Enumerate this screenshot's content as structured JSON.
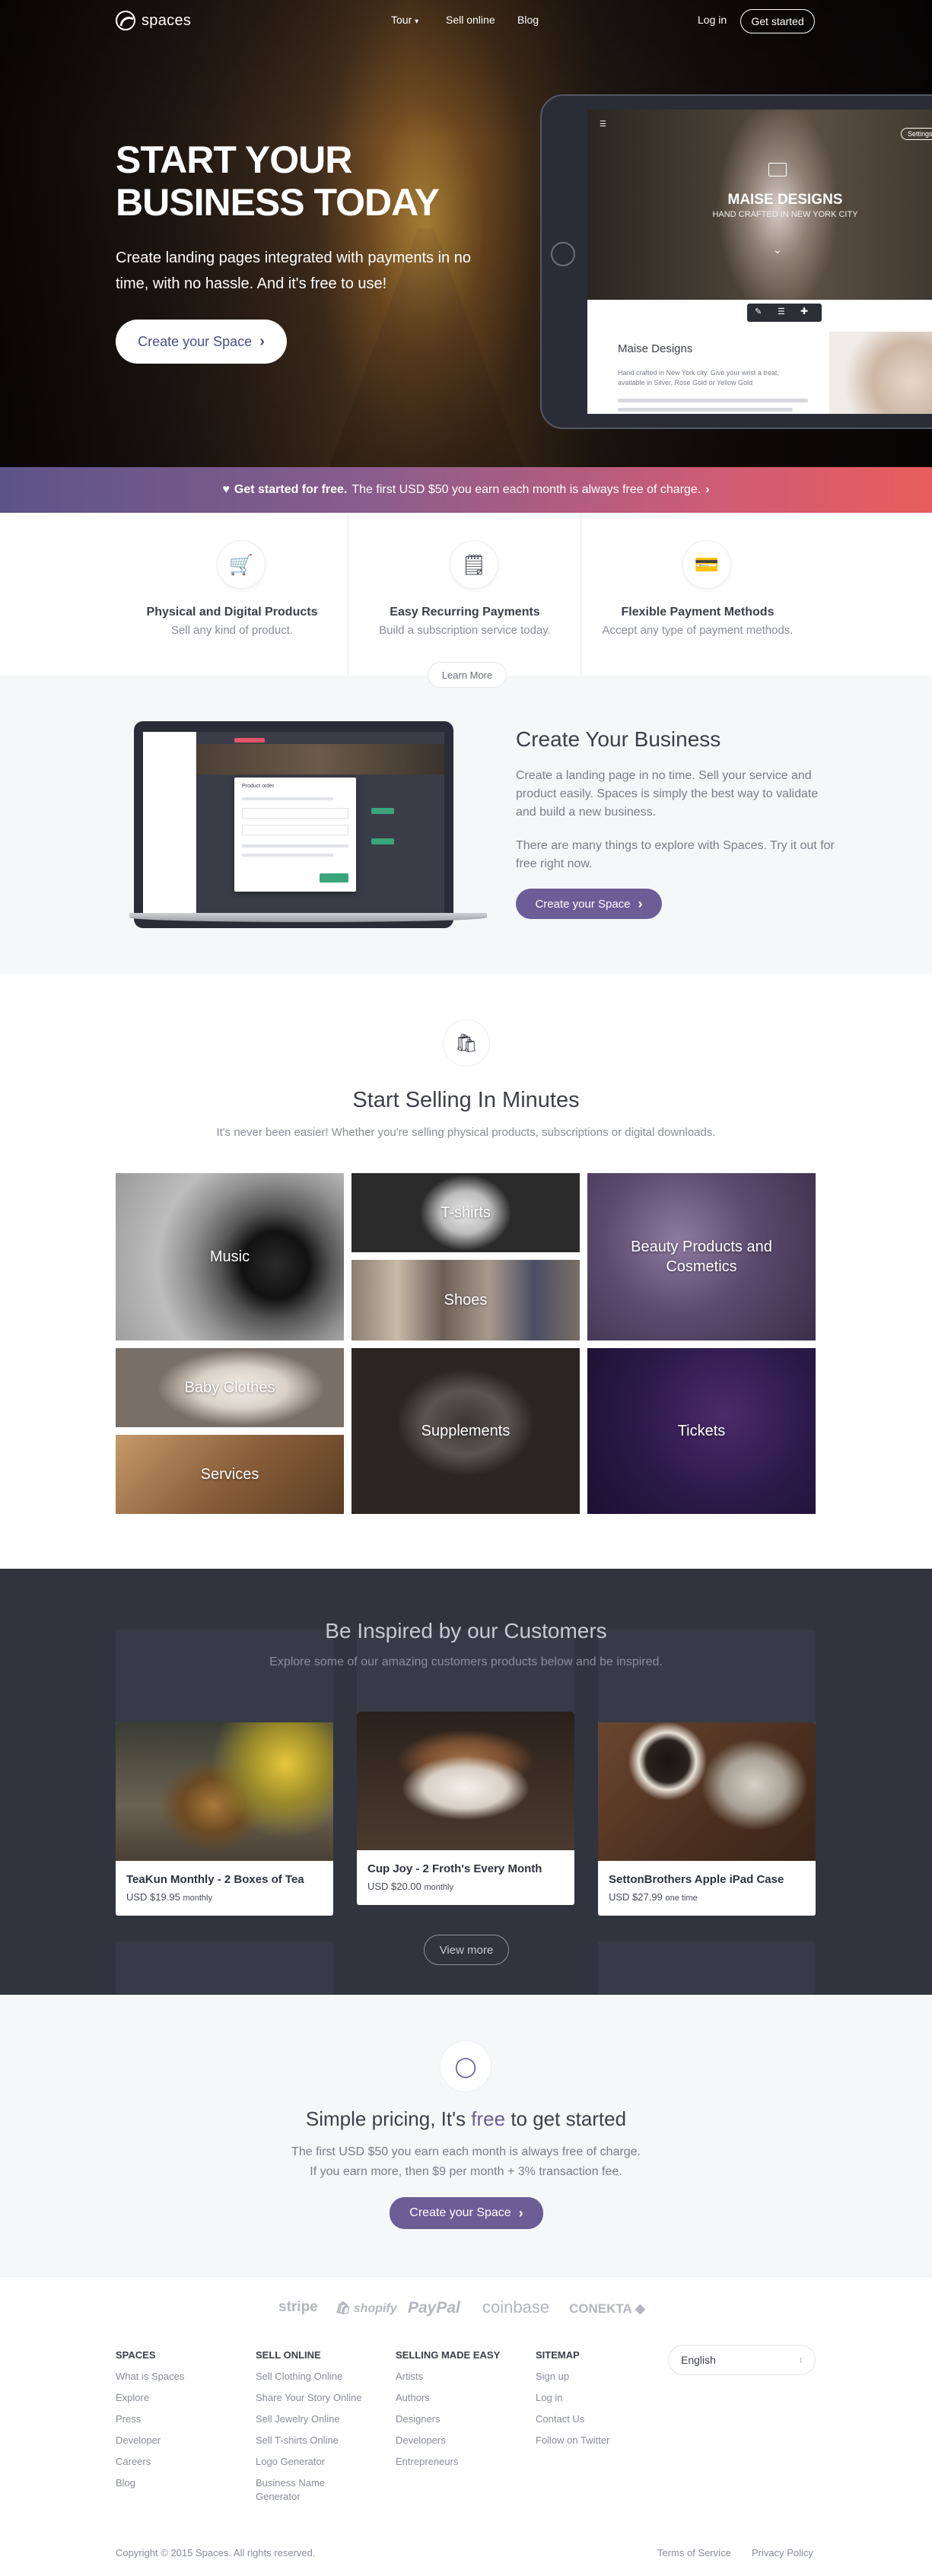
{
  "nav": {
    "brand": "spaces",
    "tour": "Tour",
    "sell_online": "Sell online",
    "blog": "Blog",
    "login": "Log in",
    "get_started": "Get started"
  },
  "hero": {
    "title_line1": "START YOUR",
    "title_line2": "BUSINESS TODAY",
    "subtitle": "Create landing pages integrated with payments in no time, with no hassle. And it's free to use!",
    "cta": "Create your Space",
    "device": {
      "title": "MAISE DESIGNS",
      "subtitle": "HAND CRAFTED IN NEW YORK CITY",
      "settings": "Settings",
      "store_name": "Maise Designs",
      "desc_line1": "Hand crafted in New York city. Give your wrist a treat,",
      "desc_line2": "available in Silver, Rose Gold or Yellow Gold"
    }
  },
  "banner": {
    "bold": "Get started for free.",
    "text": "The first USD $50 you earn each month is always free of charge."
  },
  "features": [
    {
      "title": "Physical and Digital Products",
      "subtitle": "Sell any kind of product."
    },
    {
      "title": "Easy Recurring Payments",
      "subtitle": "Build a subscription service today."
    },
    {
      "title": "Flexible Payment Methods",
      "subtitle": "Accept any type of payment methods."
    }
  ],
  "learn_more": "Learn More",
  "create": {
    "title": "Create Your Business",
    "p1": "Create a landing page in no time. Sell your service and product easily. Spaces is simply the best way to validate and build a new business.",
    "p2": "There are many things to explore with Spaces. Try it out for free right now.",
    "cta": "Create your Space",
    "laptop_modal_title": "Product order"
  },
  "selling": {
    "title": "Start Selling In Minutes",
    "subtitle": "It's never been easier! Whether you're selling physical products, subscriptions or digital downloads.",
    "tiles": {
      "music": "Music",
      "tshirts": "T-shirts",
      "beauty": "Beauty Products and Cosmetics",
      "shoes": "Shoes",
      "baby": "Baby Clothes",
      "supplements": "Supplements",
      "tickets": "Tickets",
      "services": "Services"
    }
  },
  "inspired": {
    "title": "Be Inspired by our Customers",
    "subtitle": "Explore some of our amazing customers products below and be inspired.",
    "cards": [
      {
        "title": "TeaKun Monthly - 2 Boxes of Tea",
        "price": "USD $19.95",
        "period": "monthly"
      },
      {
        "title": "Cup Joy - 2 Froth's Every Month",
        "price": "USD $20.00",
        "period": "monthly"
      },
      {
        "title": "SettonBrothers Apple iPad Case",
        "price": "USD $27.99",
        "period": "one time"
      }
    ],
    "view_more": "View more"
  },
  "pricing": {
    "title_pre": "Simple pricing, It's ",
    "title_free": "free",
    "title_post": " to get started",
    "line1": "The first USD $50 you earn each month is always free of charge.",
    "line2": "If you earn more, then $9 per month + 3% transaction fee.",
    "cta": "Create your Space"
  },
  "partners": [
    "stripe",
    "shopify",
    "PayPal",
    "coinbase",
    "CONEKTA"
  ],
  "footer": {
    "col1": {
      "heading": "SPACES",
      "links": [
        "What is Spaces",
        "Explore",
        "Press",
        "Developer",
        "Careers",
        "Blog"
      ]
    },
    "col2": {
      "heading": "SELL ONLINE",
      "links": [
        "Sell Clothing Online",
        "Share Your Story Online",
        "Sell Jewelry Online",
        "Sell T-shirts Online",
        "Logo Generator",
        "Business Name",
        "Generator"
      ]
    },
    "col3": {
      "heading": "SELLING MADE EASY",
      "links": [
        "Artists",
        "Authors",
        "Designers",
        "Developers",
        "Entrepreneurs"
      ]
    },
    "col4": {
      "heading": "SITEMAP",
      "links": [
        "Sign up",
        "Log in",
        "Contact Us",
        "Follow on Twitter"
      ]
    },
    "language": "English",
    "copyright": "Copyright © 2015 Spaces. All rights reserved.",
    "terms": "Terms of Service",
    "privacy": "Privacy Policy"
  }
}
